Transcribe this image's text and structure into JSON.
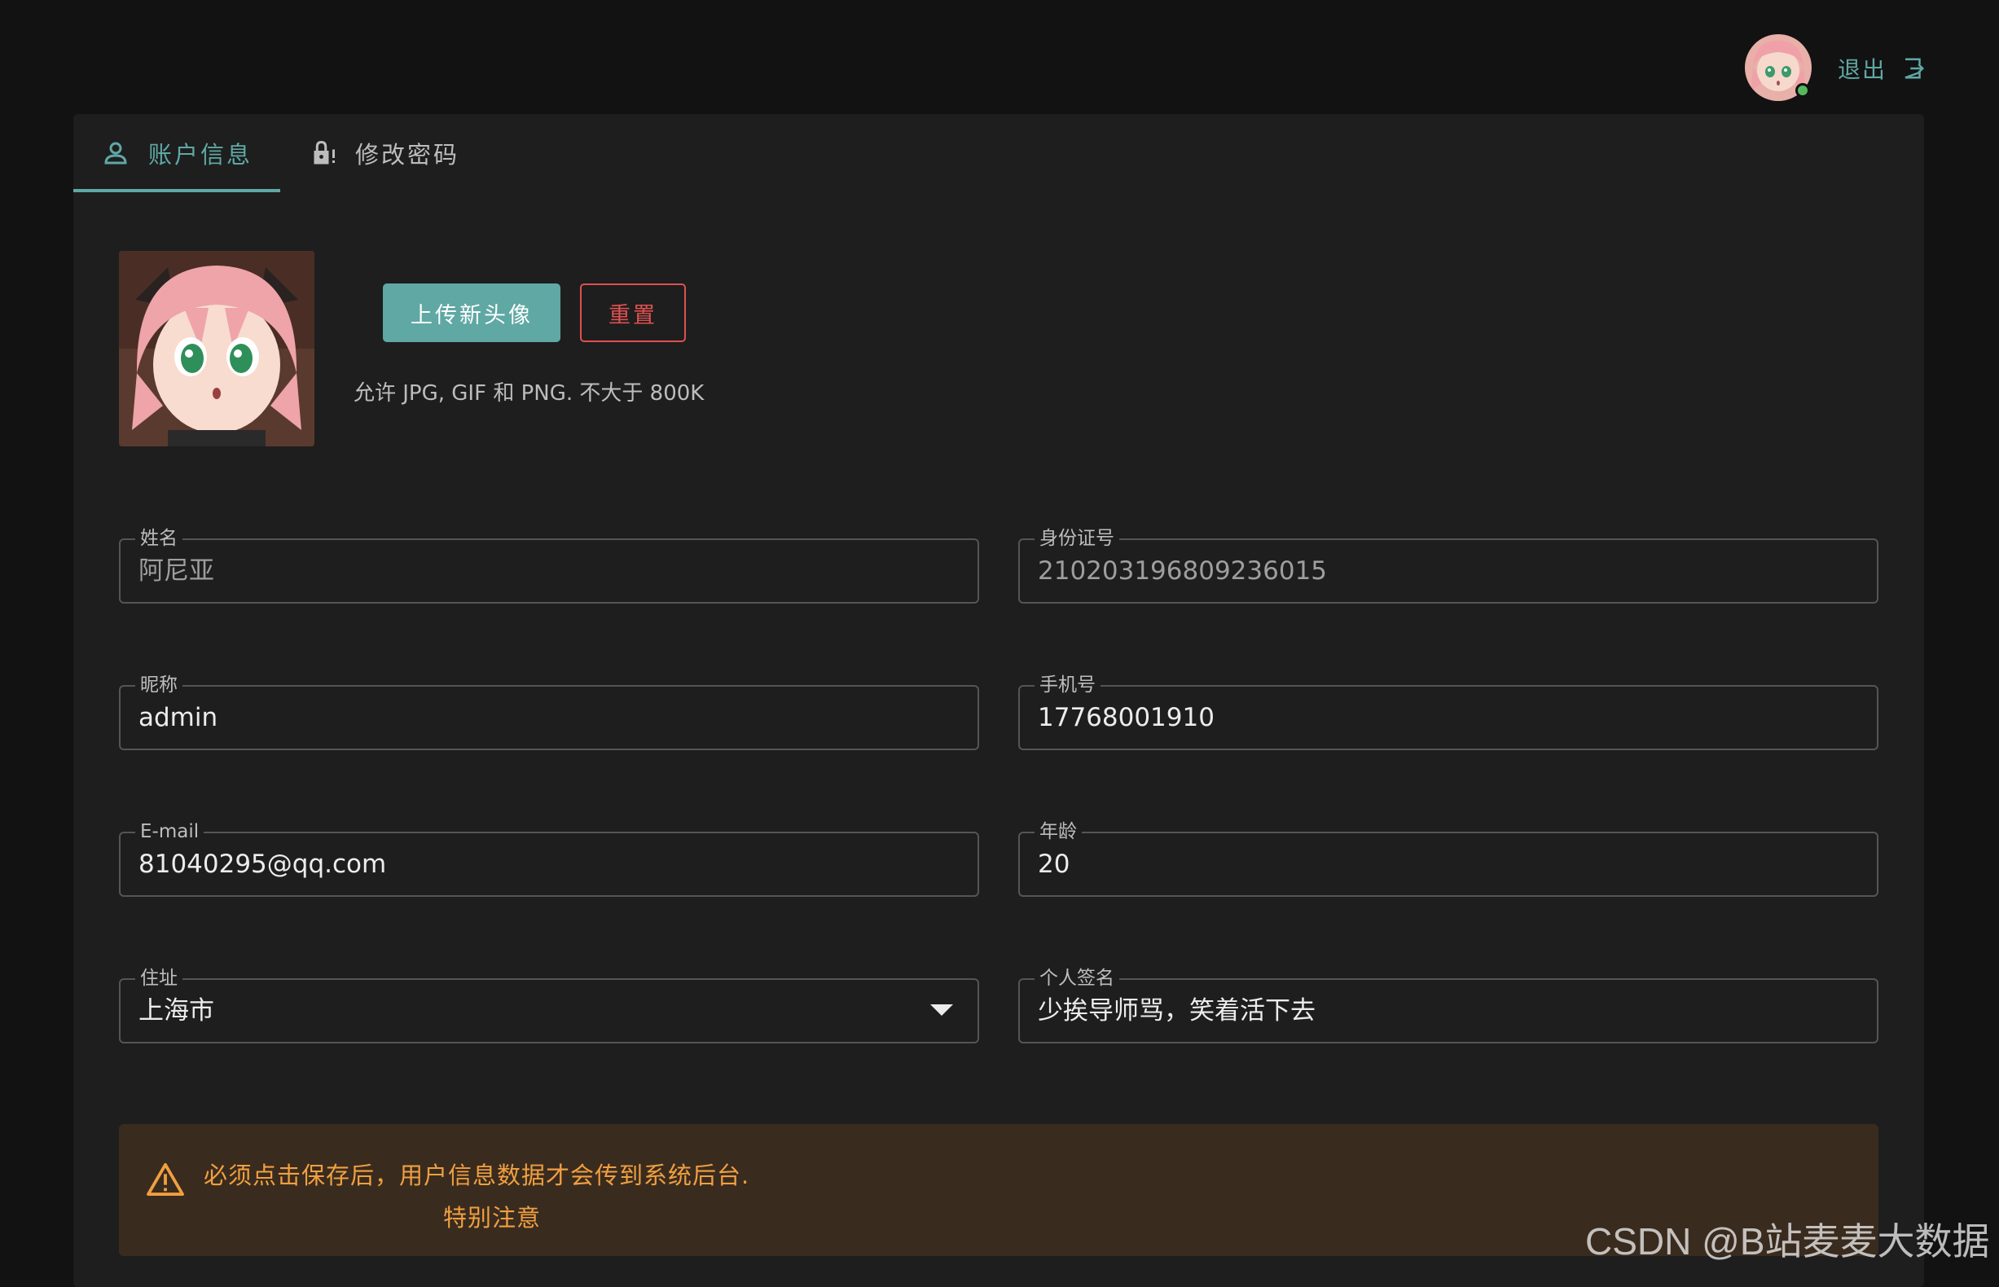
{
  "header": {
    "logout_label": "退出",
    "logout_icon": "logout-icon",
    "avatar_status_color": "#55b85e"
  },
  "tabs": [
    {
      "label": "账户信息",
      "icon": "user-icon",
      "active": true
    },
    {
      "label": "修改密码",
      "icon": "lock-alert-icon",
      "active": false
    }
  ],
  "avatar_section": {
    "upload_label": "上传新头像",
    "reset_label": "重置",
    "hint": "允许 JPG, GIF 和 PNG. 不大于 800K"
  },
  "form": {
    "name": {
      "label": "姓名",
      "value": "阿尼亚"
    },
    "id_number": {
      "label": "身份证号",
      "value": "210203196809236015"
    },
    "nickname": {
      "label": "昵称",
      "value": "admin"
    },
    "phone": {
      "label": "手机号",
      "value": "17768001910"
    },
    "email": {
      "label": "E-mail",
      "value": "81040295@qq.com"
    },
    "age": {
      "label": "年龄",
      "value": "20"
    },
    "address": {
      "label": "住址",
      "value": "上海市"
    },
    "signature": {
      "label": "个人签名",
      "value": "少挨导师骂，笑着活下去"
    }
  },
  "alert": {
    "icon": "warning-icon",
    "message": "必须点击保存后，用户信息数据才会传到系统后台.",
    "note": "特别注意"
  },
  "watermark": "CSDN @B站麦麦大数据",
  "colors": {
    "accent": "#5fa8a4",
    "danger": "#e05050",
    "warning": "#f0a040",
    "background": "#121212",
    "card": "#1e1e1e"
  }
}
